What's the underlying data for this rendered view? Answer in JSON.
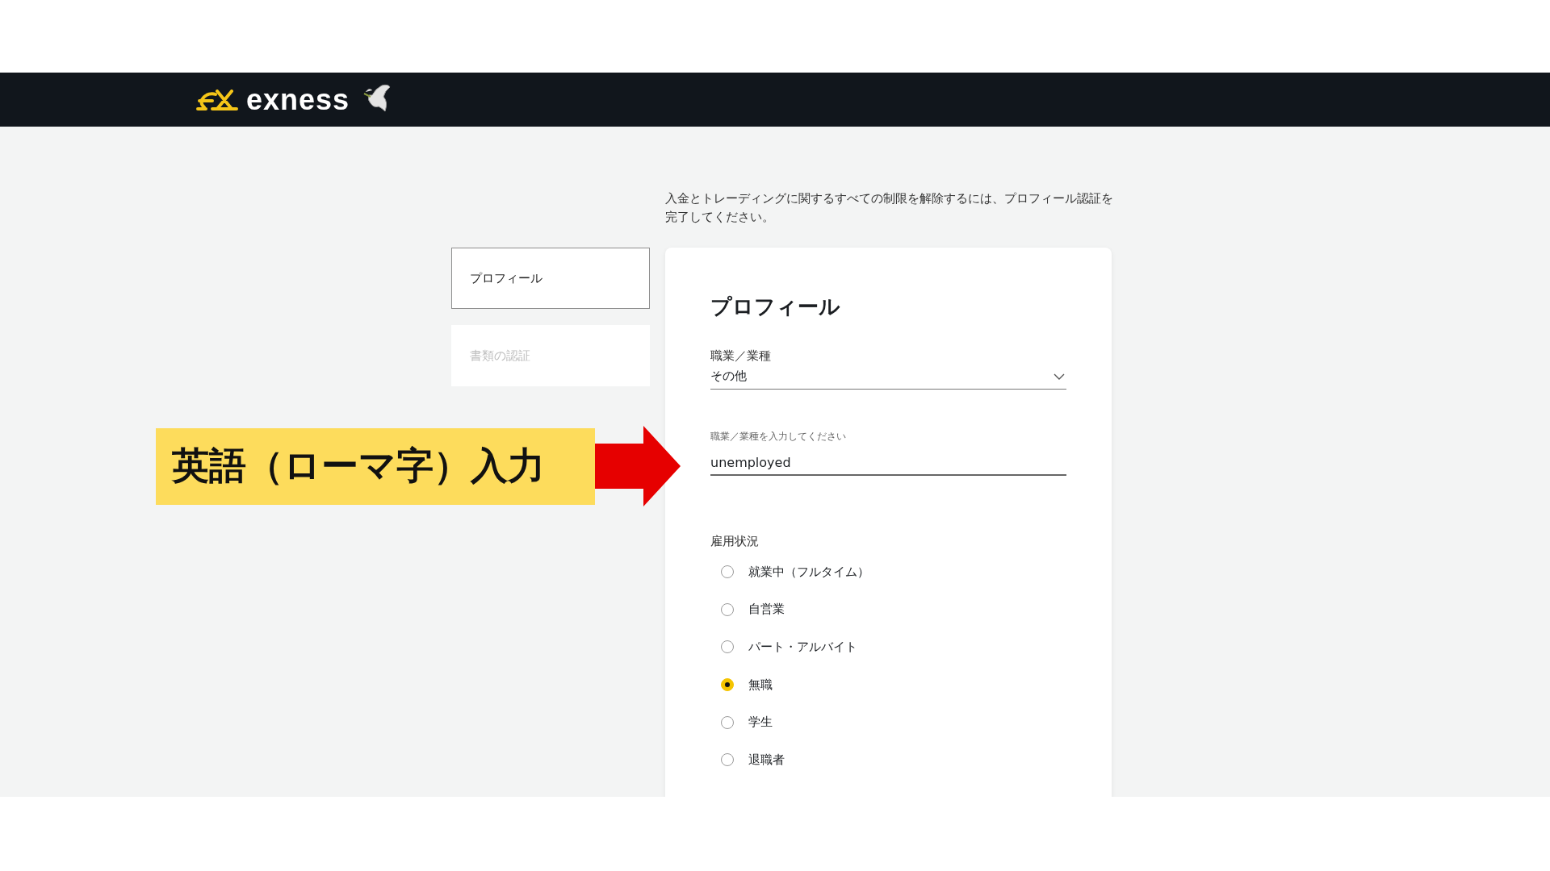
{
  "header": {
    "brand": "exness"
  },
  "intro": "入金とトレーディングに関するすべての制限を解除するには、プロフィール認証を完了してください。",
  "steps": [
    {
      "label": "プロフィール",
      "selected": true
    },
    {
      "label": "書類の認証",
      "selected": false
    }
  ],
  "card": {
    "title": "プロフィール",
    "occupation": {
      "label": "職業／業種",
      "value": "その他"
    },
    "occupation_detail": {
      "label": "職業／業種を入力してください",
      "value": "unemployed"
    },
    "employment": {
      "label": "雇用状況",
      "options": [
        {
          "label": "就業中（フルタイム）",
          "selected": false
        },
        {
          "label": "自営業",
          "selected": false
        },
        {
          "label": "パート・アルバイト",
          "selected": false
        },
        {
          "label": "無職",
          "selected": true
        },
        {
          "label": "学生",
          "selected": false
        },
        {
          "label": "退職者",
          "selected": false
        }
      ]
    }
  },
  "annotation": {
    "text": "英語（ローマ字）入力"
  }
}
